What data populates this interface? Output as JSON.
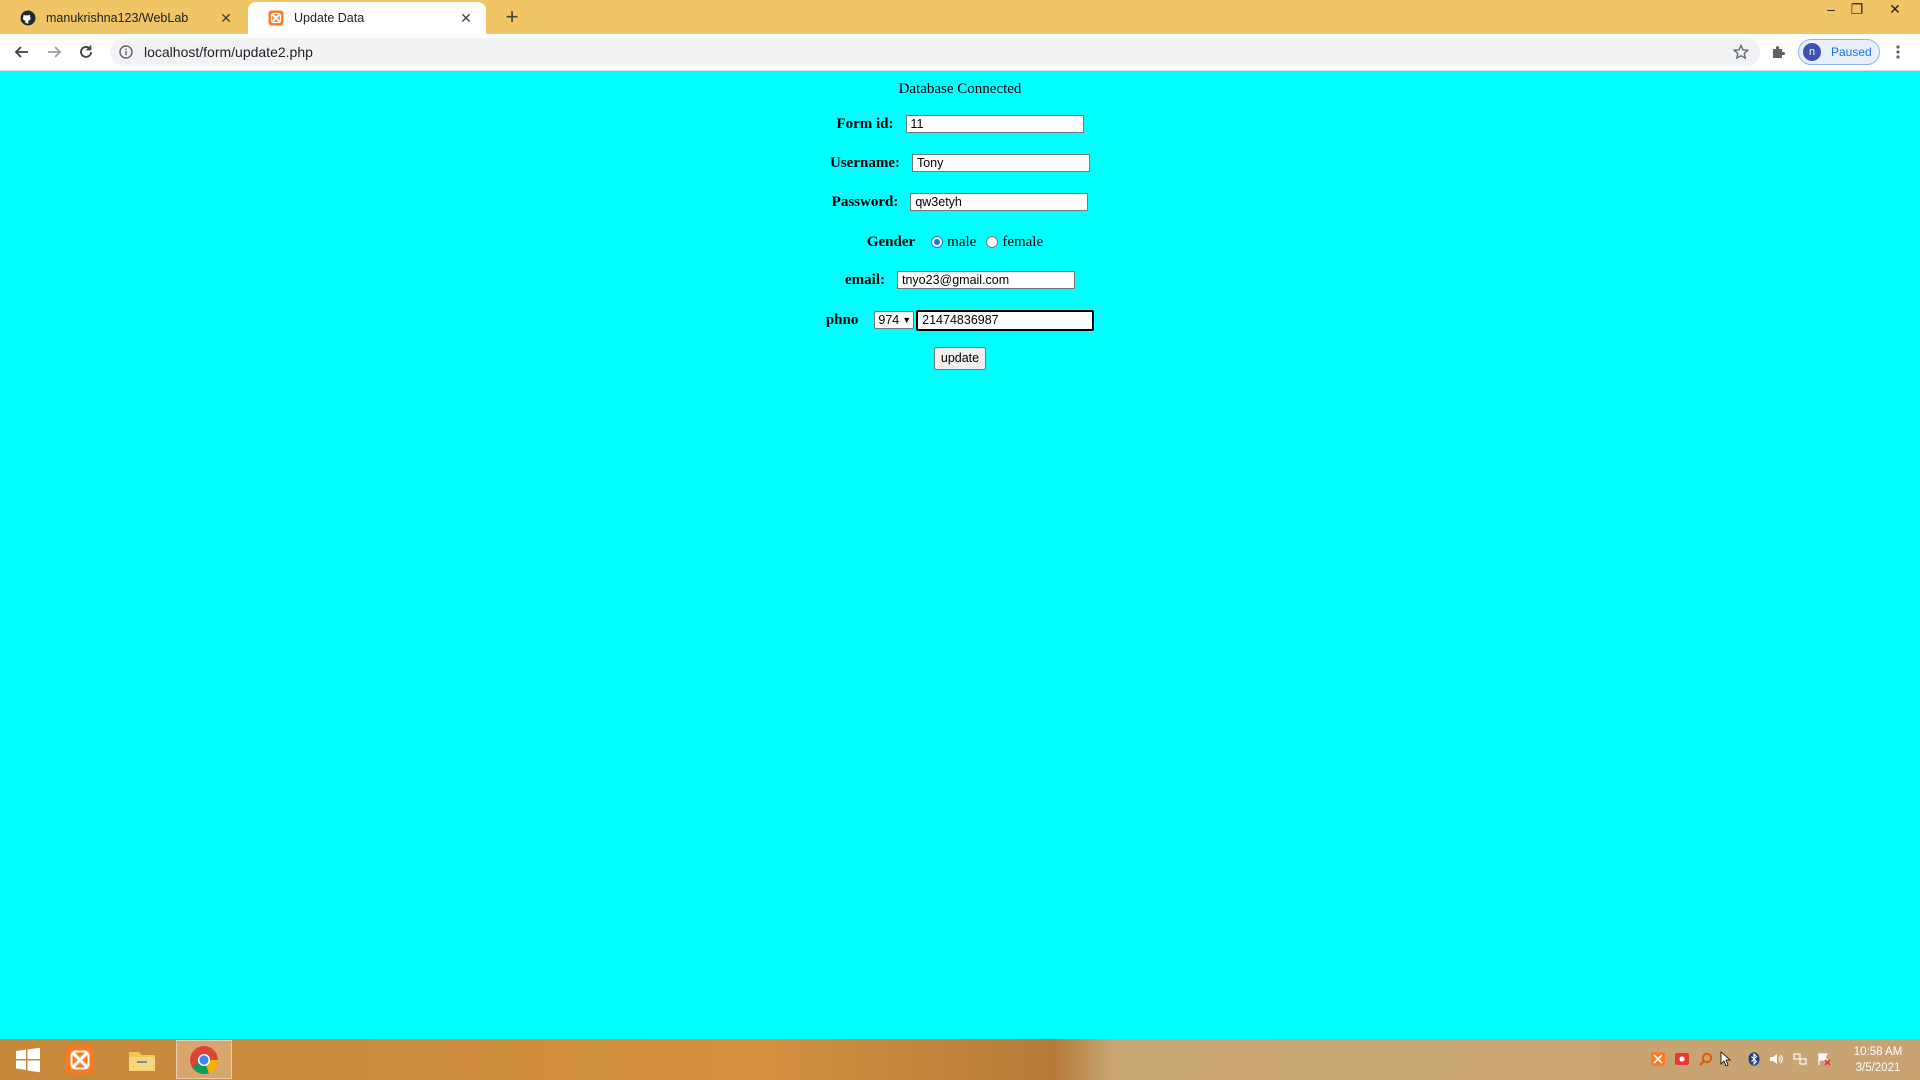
{
  "browser": {
    "tabs": [
      {
        "title": "manukrishna123/WebLab",
        "icon": "github-icon",
        "active": false
      },
      {
        "title": "Update Data",
        "icon": "xampp-icon",
        "active": true
      }
    ],
    "url": "localhost/form/update2.php",
    "profile_initial": "n",
    "profile_label": "Paused"
  },
  "page": {
    "status": "Database Connected",
    "fields": {
      "form_id": {
        "label": "Form id:",
        "value": "11"
      },
      "username": {
        "label": "Username:",
        "value": "Tony"
      },
      "password": {
        "label": "Password:",
        "value": "qw3etyh"
      },
      "gender": {
        "label": "Gender",
        "options": [
          "male",
          "female"
        ],
        "selected": "male"
      },
      "email": {
        "label": "email:",
        "value": "tnyo23@gmail.com"
      },
      "phone": {
        "label": "phno",
        "code": "974",
        "value": "21474836987"
      }
    },
    "submit_label": "update"
  },
  "taskbar": {
    "time": "10:58 AM",
    "date": "3/5/2021"
  },
  "colors": {
    "page_background": "#00ffff",
    "tabstrip": "#f0c566",
    "accent": "#1a73e8"
  }
}
